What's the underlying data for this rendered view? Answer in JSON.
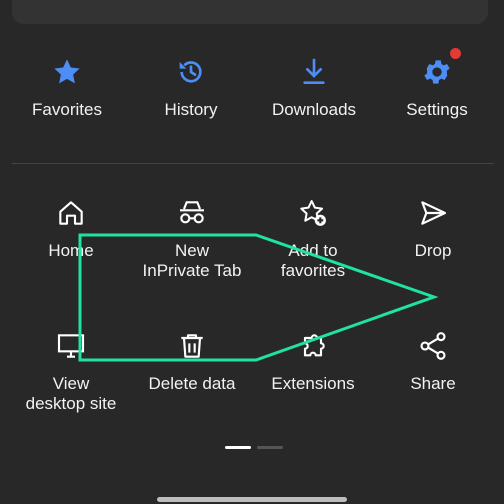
{
  "colors": {
    "background": "#282828",
    "accent_blue": "#4c8df6",
    "notification_red": "#e53935",
    "annotation_green": "#1fe39e"
  },
  "top_row": [
    {
      "label": "Favorites",
      "icon": "star-icon"
    },
    {
      "label": "History",
      "icon": "history-icon"
    },
    {
      "label": "Downloads",
      "icon": "download-icon"
    },
    {
      "label": "Settings",
      "icon": "gear-icon"
    }
  ],
  "grid_row1": [
    {
      "label": "Home",
      "icon": "home-icon"
    },
    {
      "label": "New\nInPrivate Tab",
      "icon": "inprivate-icon"
    },
    {
      "label": "Add to\nfavorites",
      "icon": "star-add-icon"
    },
    {
      "label": "Drop",
      "icon": "send-icon"
    }
  ],
  "grid_row2": [
    {
      "label": "View\ndesktop site",
      "icon": "desktop-icon"
    },
    {
      "label": "Delete data",
      "icon": "trash-icon"
    },
    {
      "label": "Extensions",
      "icon": "puzzle-icon"
    },
    {
      "label": "Share",
      "icon": "share-icon"
    }
  ],
  "pager": {
    "active_page": 1,
    "total_pages": 2
  }
}
